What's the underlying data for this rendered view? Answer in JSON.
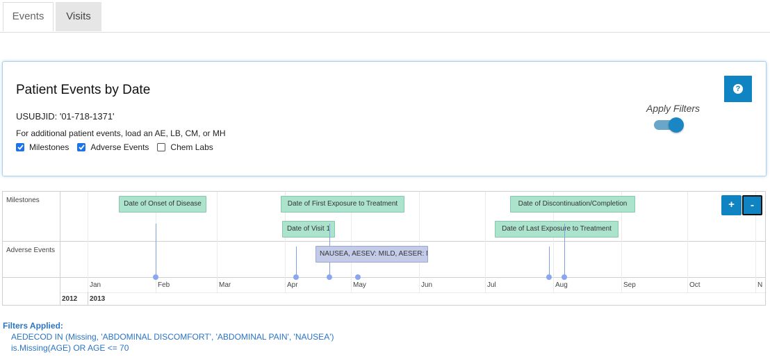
{
  "tabs": [
    {
      "label": "Events",
      "active": true
    },
    {
      "label": "Visits",
      "active": false
    }
  ],
  "panel": {
    "title": "Patient Events by Date",
    "usubjid": "USUBJID: '01-718-1371'",
    "note": "For additional patient events, load an AE, LB, CM, or MH",
    "checkboxes": [
      {
        "label": "Milestones",
        "checked": true
      },
      {
        "label": "Adverse Events",
        "checked": true
      },
      {
        "label": "Chem Labs",
        "checked": false
      }
    ],
    "apply_filters_label": "Apply Filters",
    "apply_filters_on": true,
    "help_icon": "question-circle-icon"
  },
  "timeline": {
    "rows": [
      "Milestones",
      "Adverse Events"
    ],
    "years": [
      "2012",
      "2013"
    ],
    "months": [
      "Jan",
      "Feb",
      "Mar",
      "Apr",
      "May",
      "Jun",
      "Jul",
      "Aug",
      "Sep",
      "Oct",
      "N"
    ],
    "milestones": [
      {
        "label": "Date of Onset of Disease",
        "date": "2013-02-01"
      },
      {
        "label": "Date of Visit 1",
        "date": "2013-04-06"
      },
      {
        "label": "Date of First Exposure to Treatment",
        "date": "2013-04-21"
      },
      {
        "label": "Date of Last Exposure to Treatment",
        "date": "2013-07-30"
      },
      {
        "label": "Date of Discontinuation/Completion",
        "date": "2013-08-06"
      }
    ],
    "adverse_events": [
      {
        "label": "NAUSEA, AESEV: MILD, AESER: N",
        "date": "2013-05-04"
      }
    ],
    "zoom_in_label": "+",
    "zoom_out_label": "-"
  },
  "filters": {
    "title": "Filters Applied:",
    "items": [
      "AEDECOD IN (Missing, 'ABDOMINAL DISCOMFORT', 'ABDOMINAL PAIN', 'NAUSEA')",
      "is.Missing(AGE) OR AGE <= 70"
    ]
  },
  "colors": {
    "accent": "#1083c2",
    "milestone_fill": "#ace3cc",
    "ae_fill": "#c3cbe8",
    "filter_text": "#2a74c4"
  }
}
